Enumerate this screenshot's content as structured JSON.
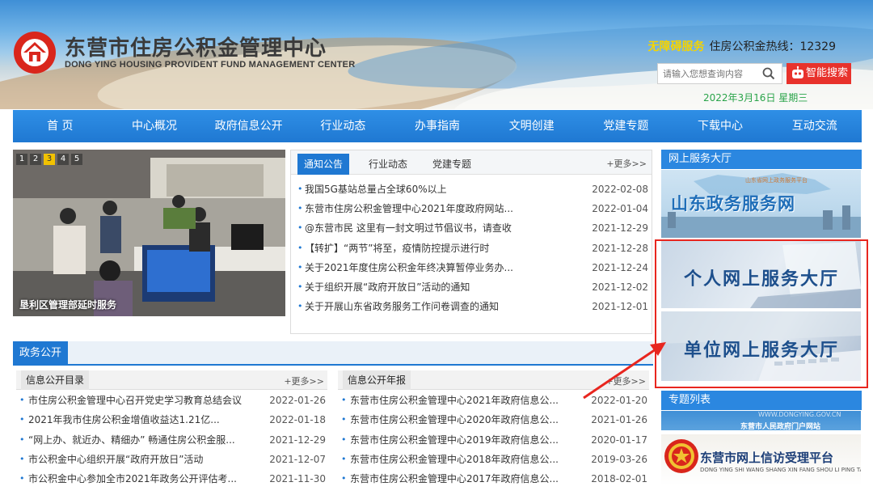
{
  "header": {
    "title": "东营市住房公积金管理中心",
    "subtitle": "DONG YING HOUSING PROVIDENT FUND MANAGEMENT CENTER",
    "accessibility": "无障碍服务",
    "hotline": "住房公积金热线：12329",
    "search_placeholder": "请输入您想查询内容",
    "smart_search": "智能搜索",
    "date": "2022年3月16日 星期三"
  },
  "nav": [
    "首 页",
    "中心概况",
    "政府信息公开",
    "行业动态",
    "办事指南",
    "文明创建",
    "党建专题",
    "下载中心",
    "互动交流"
  ],
  "slideshow": {
    "pages": [
      "1",
      "2",
      "3",
      "4",
      "5"
    ],
    "active": "3",
    "caption": "垦利区管理部延时服务"
  },
  "notices": {
    "tabs": [
      "通知公告",
      "行业动态",
      "党建专题"
    ],
    "more": "+更多>>",
    "items": [
      {
        "title": "我国5G基站总量占全球60%以上",
        "date": "2022-02-08"
      },
      {
        "title": "东营市住房公积金管理中心2021年度政府网站...",
        "date": "2022-01-04"
      },
      {
        "title": "@东营市民 这里有一封文明过节倡议书，请查收",
        "date": "2021-12-29"
      },
      {
        "title": "【转扩】“两节”将至，疫情防控提示进行时",
        "date": "2021-12-28"
      },
      {
        "title": "关于2021年度住房公积金年终决算暂停业务办...",
        "date": "2021-12-24"
      },
      {
        "title": "关于组织开展“政府开放日”活动的通知",
        "date": "2021-12-02"
      },
      {
        "title": "关于开展山东省政务服务工作问卷调查的通知",
        "date": "2021-12-01"
      }
    ]
  },
  "gov": {
    "title": "政务公开",
    "left": {
      "title": "信息公开目录",
      "more": "+更多>>",
      "items": [
        {
          "title": "市住房公积金管理中心召开党史学习教育总结会议",
          "date": "2022-01-26"
        },
        {
          "title": "2021年我市住房公积金增值收益达1.21亿...",
          "date": "2022-01-18"
        },
        {
          "title": "“网上办、就近办、精细办” 畅通住房公积金服...",
          "date": "2021-12-29"
        },
        {
          "title": "市公积金中心组织开展“政府开放日”活动",
          "date": "2021-12-07"
        },
        {
          "title": "市公积金中心参加全市2021年政务公开评估考...",
          "date": "2021-11-30"
        }
      ]
    },
    "right": {
      "title": "信息公开年报",
      "more": "+更多>>",
      "items": [
        {
          "title": "东营市住房公积金管理中心2021年政府信息公...",
          "date": "2022-01-20"
        },
        {
          "title": "东营市住房公积金管理中心2020年政府信息公...",
          "date": "2021-01-26"
        },
        {
          "title": "东营市住房公积金管理中心2019年政府信息公...",
          "date": "2020-01-17"
        },
        {
          "title": "东营市住房公积金管理中心2018年政府信息公...",
          "date": "2019-03-26"
        },
        {
          "title": "东营市住房公积金管理中心2017年政府信息公...",
          "date": "2018-02-01"
        }
      ]
    }
  },
  "sidebar": {
    "service_hall": "网上服务大厅",
    "shandong": "山东政务服务网",
    "shandong_small": "山东省网上政务服务平台",
    "personal": "个人网上服务大厅",
    "unit": "单位网上服务大厅",
    "topics": "专题列表",
    "topic1_caption": "东营市人民政府门户网站",
    "topic1_url": "WWW.DONGYING.GOV.CN",
    "topic2_title": "东营市网上信访受理平台",
    "topic2_sub": "DONG YING SHI WANG SHANG XIN FANG SHOU LI PING TAI"
  },
  "colors": {
    "brand_blue": "#1f78d2",
    "accent_red": "#e8322c",
    "date_green": "#2aa44a",
    "hotline_yellow": "#f5d400"
  }
}
